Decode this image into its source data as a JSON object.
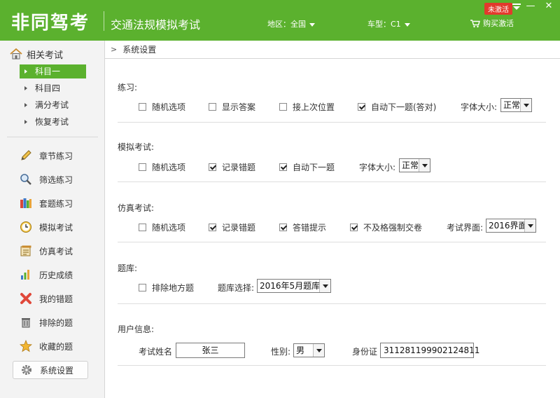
{
  "header": {
    "logo": "非同驾考",
    "subtitle": "交通法规模拟考试",
    "region_label": "地区：全国",
    "cartype_label": "车型：C1",
    "buy_label": "购买激活",
    "badge": "未激活",
    "minimize": "—",
    "close": "✕",
    "bg_color": "#5bb12e"
  },
  "sidebar": {
    "home_label": "相关考试",
    "sub_items": [
      {
        "label": "科目一",
        "active": true
      },
      {
        "label": "科目四",
        "active": false
      },
      {
        "label": "满分考试",
        "active": false
      },
      {
        "label": "恢复考试",
        "active": false
      }
    ],
    "nav_items": [
      {
        "label": "章节练习",
        "icon": "pencil-icon"
      },
      {
        "label": "筛选练习",
        "icon": "magnifier-icon"
      },
      {
        "label": "套题练习",
        "icon": "books-icon"
      },
      {
        "label": "模拟考试",
        "icon": "clock-icon"
      },
      {
        "label": "仿真考试",
        "icon": "document-icon"
      },
      {
        "label": "历史成绩",
        "icon": "bar-chart-icon"
      },
      {
        "label": "我的错题",
        "icon": "red-x-icon"
      },
      {
        "label": "排除的题",
        "icon": "trash-icon"
      },
      {
        "label": "收藏的题",
        "icon": "star-icon"
      },
      {
        "label": "系统设置",
        "icon": "gear-icon",
        "selected": true
      }
    ]
  },
  "main": {
    "breadcrumb": "系统设置",
    "practice": {
      "title": "练习:",
      "random": "随机选项",
      "show_answer": "显示答案",
      "resume": "接上次位置",
      "auto_next": "自动下一题(答对)",
      "font_label": "字体大小:",
      "font_value": "正常"
    },
    "mock": {
      "title": "模拟考试:",
      "random": "随机选项",
      "record_wrong": "记录错题",
      "auto_next": "自动下一题",
      "font_label": "字体大小:",
      "font_value": "正常"
    },
    "sim": {
      "title": "仿真考试:",
      "random": "随机选项",
      "record_wrong": "记录错题",
      "wrong_hint": "答错提示",
      "force_submit": "不及格强制交卷",
      "ui_label": "考试界面:",
      "ui_value": "2016界面"
    },
    "bank": {
      "title": "题库:",
      "exclude_local": "排除地方题",
      "select_label": "题库选择:",
      "select_value": "2016年5月题库"
    },
    "user": {
      "title": "用户信息:",
      "name_label": "考试姓名",
      "name_value": "张三",
      "gender_label": "性别:",
      "gender_value": "男",
      "id_label": "身份证",
      "id_value": "311281199902124811"
    }
  }
}
